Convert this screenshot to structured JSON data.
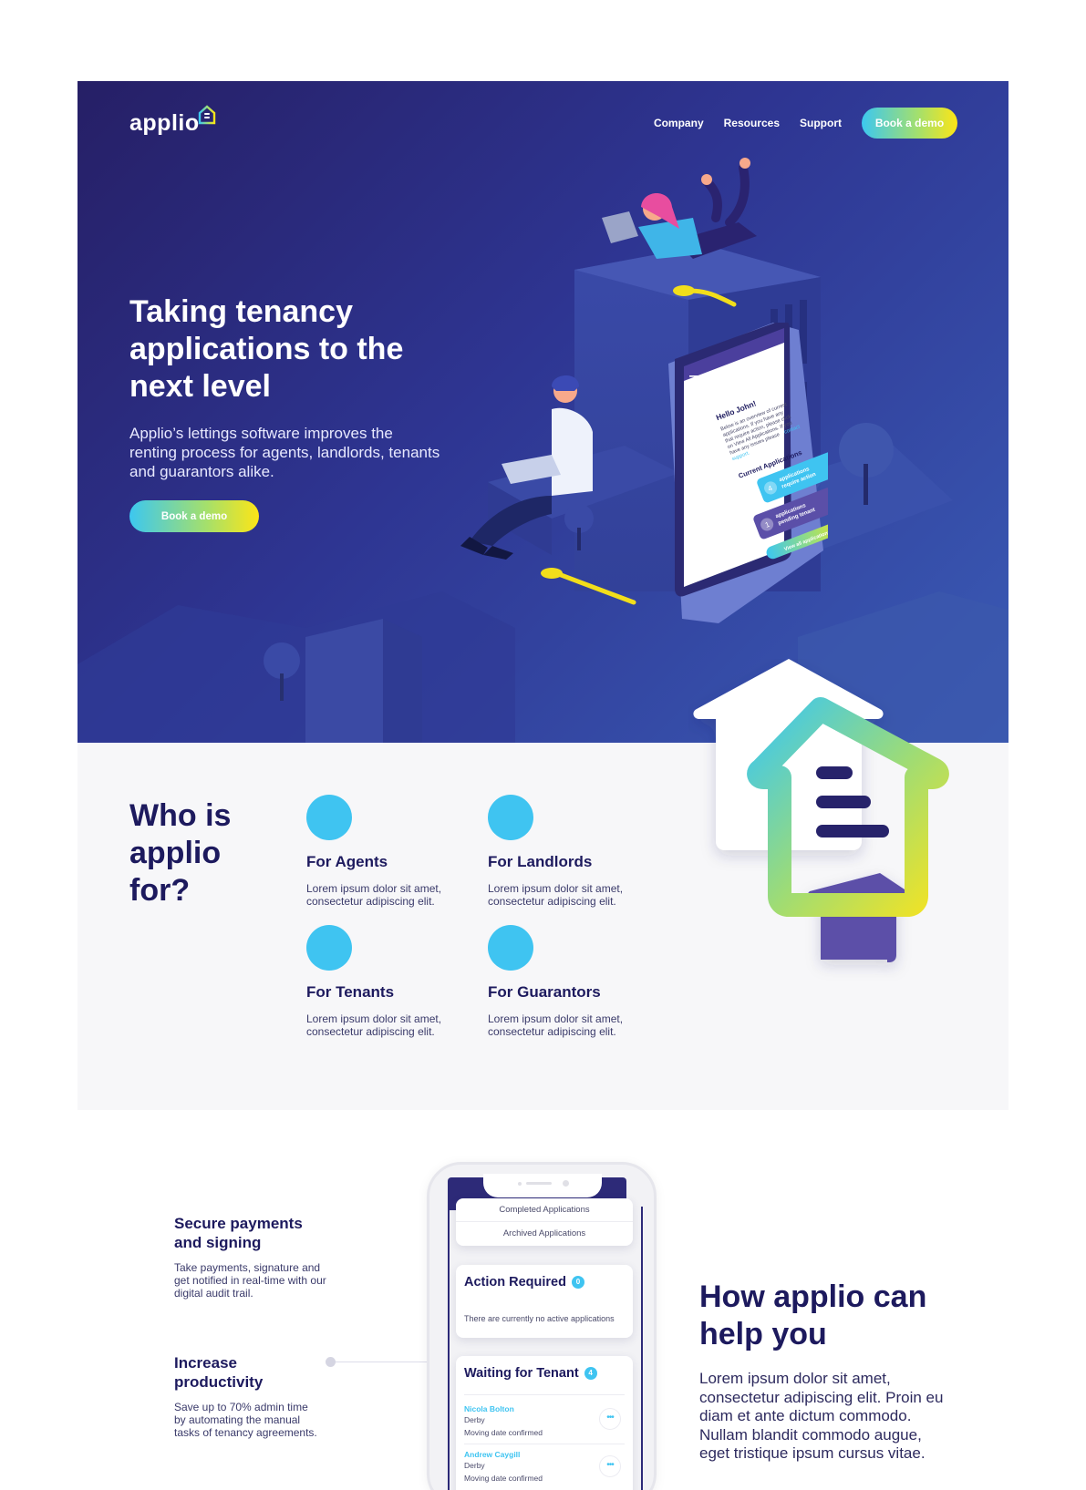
{
  "nav": {
    "logo_text": "applio",
    "logo_mark_text": "",
    "items": [
      "Company",
      "Resources",
      "Support"
    ],
    "cta_label": "Book a demo"
  },
  "hero": {
    "title": "Taking tenancy applications to the next level",
    "lead": "Applio’s lettings software improves the renting process for agents, landlords, tenants and guarantors alike.",
    "cta_label": "Book a demo",
    "phone": {
      "header": "Dashboard",
      "greeting": "Hello John!",
      "body_1": "Below is an overview of current",
      "body_2": "applications. If you have any",
      "body_3": "that require action, please click",
      "body_4": "on View All Applications. If you",
      "body_5": "have any issues please",
      "link_1": "contact",
      "link_2": "support.",
      "section": "Current Applications",
      "pill1_count": "4",
      "pill1_line1": "applications",
      "pill1_line2": "require action",
      "pill2_count": "1",
      "pill2_line1": "applications",
      "pill2_line2": "pending tenant",
      "view_all": "View all applications"
    }
  },
  "who": {
    "title": "Who is applio for?",
    "features": [
      {
        "title": "For Agents",
        "text": "Lorem ipsum dolor sit amet, consectetur adipiscing elit."
      },
      {
        "title": "For Landlords",
        "text": "Lorem ipsum dolor sit amet, consectetur adipiscing elit."
      },
      {
        "title": "For Tenants",
        "text": "Lorem ipsum dolor sit amet, consectetur adipiscing elit."
      },
      {
        "title": "For Guarantors",
        "text": "Lorem ipsum dolor sit amet, consectetur adipiscing elit."
      }
    ]
  },
  "how": {
    "items": [
      {
        "title": "Secure payments and signing",
        "text": "Take payments, signature and get notified in real-time with our digital audit trail."
      },
      {
        "title": "Increase productivity",
        "text": "Save up to 70%  admin time by automating the manual tasks of tenancy agreements."
      }
    ],
    "title": "How applio can help you",
    "text": "Lorem ipsum dolor sit amet, consectetur adipiscing elit. Proin eu diam et ante dictum commodo. Nullam blandit commodo augue, eget tristique ipsum cursus vitae.",
    "phone": {
      "menu": [
        "Completed Applications",
        "Archived Applications"
      ],
      "action_title": "Action Required",
      "action_count": "0",
      "action_text": "There are currently no active applications",
      "waiting_title": "Waiting for Tenant",
      "waiting_count": "4",
      "tenants": [
        {
          "name": "Nicola Bolton",
          "city": "Derby",
          "status": "Moving date confirmed"
        },
        {
          "name": "Andrew Caygill",
          "city": "Derby",
          "status": "Moving date confirmed"
        }
      ]
    }
  },
  "colors": {
    "navy": "#1d1a5e",
    "hero_start": "#261f66",
    "hero_end": "#3a5bb5",
    "accent_blue": "#3fc4f1",
    "accent_yellow": "#fde516",
    "purple": "#5b4fa8"
  }
}
